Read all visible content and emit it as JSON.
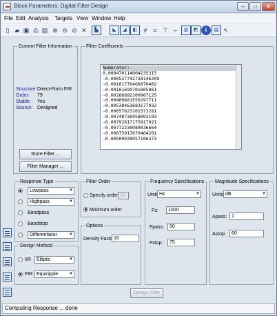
{
  "window": {
    "title": "Block Parameters: Digital Filter Design",
    "controls": {
      "minimize": "–",
      "maximize": "□",
      "close": "✕"
    }
  },
  "menu": [
    "File",
    "Edit",
    "Analysis",
    "Targets",
    "View",
    "Window",
    "Help"
  ],
  "toolbar_icons": [
    "new-icon",
    "open-icon",
    "save-icon",
    "print-icon",
    "print-preview-icon",
    "zoom-in-icon",
    "zoom-out-icon",
    "full-view-icon",
    "filter-specs-icon",
    "magnitude-response-icon",
    "phase-response-icon",
    "mag-phase-icon",
    "group-delay-icon",
    "pole-zero-icon",
    "impulse-response-icon",
    "step-response-icon",
    "coefficients-icon",
    "info-icon",
    "filter-coefficients-icon",
    "whats-this-icon"
  ],
  "current_filter": {
    "legend": "Current Filter Information",
    "fields": [
      {
        "label": "Structure:",
        "value": "Direct-Form FIR"
      },
      {
        "label": "Order:",
        "value": "79"
      },
      {
        "label": "Stable:",
        "value": "Yes"
      },
      {
        "label": "Source:",
        "value": "Designed"
      }
    ],
    "store_button": "Store Filter ...",
    "manager_button": "Filter Manager ..."
  },
  "coefficients": {
    "legend": "Filter Coefficients",
    "header": "Numerator:",
    "values": [
      "0.000470114004235315",
      "-0.000527742738146309",
      "-0.00101776466870402",
      "-0.00181699701805861",
      "-0.00286892100987125",
      "-0.00409681550297711",
      "-0.00538463683177932",
      "-0.00657623101573281",
      "-0.00748736958003193",
      "-0.00792617175917921",
      "-0.00772236080036664",
      "-0.00675917670464201",
      "-0.00500038957106373"
    ]
  },
  "response_type": {
    "legend": "Response Type",
    "options": [
      {
        "label": "Lowpass",
        "selected": true,
        "dropdown": true
      },
      {
        "label": "Highpass",
        "selected": false,
        "dropdown": true
      },
      {
        "label": "Bandpass",
        "selected": false,
        "dropdown": false
      },
      {
        "label": "Bandstop",
        "selected": false,
        "dropdown": false
      },
      {
        "label": "Differentiator",
        "selected": false,
        "dropdown": true
      }
    ]
  },
  "design_method": {
    "legend": "Design Method",
    "iir_label": "IIR",
    "iir_value": "Elliptic",
    "fir_label": "FIR",
    "fir_value": "Equiripple",
    "selected": "FIR"
  },
  "filter_order": {
    "legend": "Filter Order",
    "specify_label": "Specify order:",
    "specify_value": "10",
    "minimum_label": "Minimum order",
    "selected": "minimum"
  },
  "options": {
    "legend": "Options",
    "density_label": "Density Factor:",
    "density_value": "16"
  },
  "frequency_specs": {
    "legend": "Frequency Specifications",
    "units_label": "Units:",
    "units_value": "Hz",
    "fields": [
      {
        "label": "Fs:",
        "value": "1000"
      },
      {
        "label": "Fpass:",
        "value": "50"
      },
      {
        "label": "Fstop:",
        "value": "75"
      }
    ]
  },
  "magnitude_specs": {
    "legend": "Magnitude Specifications",
    "units_label": "Units:",
    "units_value": "dB",
    "fields": [
      {
        "label": "Apass:",
        "value": "1"
      },
      {
        "label": "Astop:",
        "value": "60"
      }
    ]
  },
  "side_icons": [
    "design-filter-panel-icon",
    "transform-filter-icon",
    "create-multirate-icon",
    "realize-model-icon",
    "pole-zero-editor-icon"
  ],
  "design_button": "Design Filter",
  "status": "Computing Response ... done"
}
